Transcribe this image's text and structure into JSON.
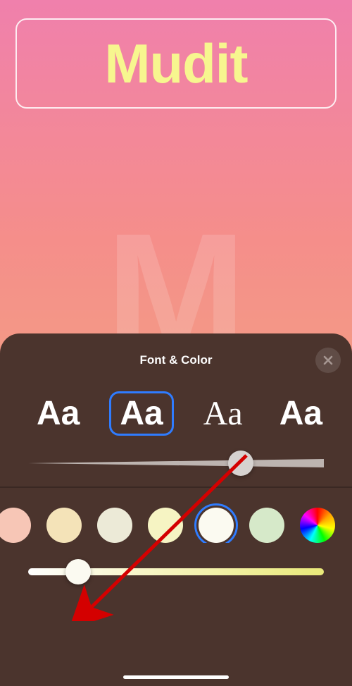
{
  "name": "Mudit",
  "watermark_letter": "M",
  "panel": {
    "title": "Font & Color",
    "fonts": [
      {
        "sample": "Aa",
        "selected": false
      },
      {
        "sample": "Aa",
        "selected": true
      },
      {
        "sample": "Aa",
        "selected": false
      },
      {
        "sample": "Aa",
        "selected": false
      }
    ],
    "weight_slider_percent": 72,
    "colors": [
      {
        "hex": "#f7c6b6",
        "selected": false
      },
      {
        "hex": "#f4e3b8",
        "selected": false
      },
      {
        "hex": "#ecead7",
        "selected": false
      },
      {
        "hex": "#f6f4c3",
        "selected": false
      },
      {
        "hex": "#fbfaf1",
        "selected": true
      },
      {
        "hex": "#d6e9c9",
        "selected": false
      },
      {
        "rainbow": true,
        "selected": false
      }
    ],
    "tint_slider_percent": 17
  }
}
